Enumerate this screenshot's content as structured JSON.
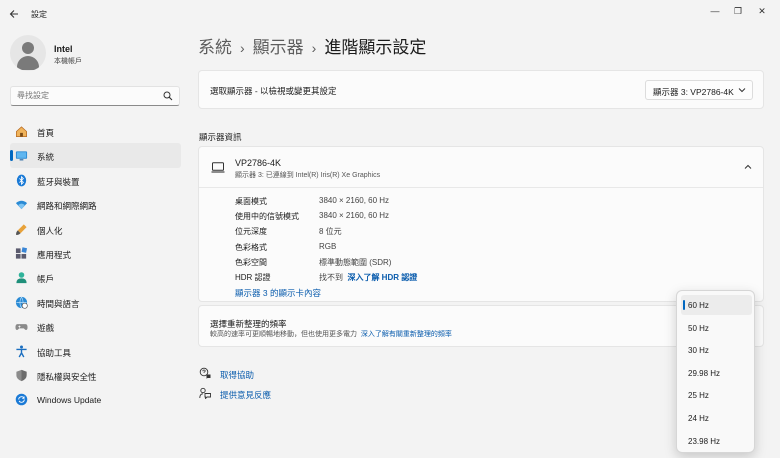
{
  "window": {
    "title": "設定",
    "back_icon": "back-arrow-icon",
    "minimize_glyph": "—",
    "maximize_glyph": "❐",
    "close_glyph": "✕"
  },
  "profile": {
    "name": "Intel",
    "subtitle": "本機帳戶"
  },
  "search": {
    "placeholder": "尋找設定"
  },
  "sidebar": {
    "items": [
      {
        "label": "首頁",
        "icon": "home-icon",
        "selected": false
      },
      {
        "label": "系統",
        "icon": "system-icon",
        "selected": true
      },
      {
        "label": "藍牙與裝置",
        "icon": "bluetooth-icon",
        "selected": false
      },
      {
        "label": "網路和網際網路",
        "icon": "wifi-icon",
        "selected": false
      },
      {
        "label": "個人化",
        "icon": "personalize-icon",
        "selected": false
      },
      {
        "label": "應用程式",
        "icon": "apps-icon",
        "selected": false
      },
      {
        "label": "帳戶",
        "icon": "accounts-icon",
        "selected": false
      },
      {
        "label": "時間與語言",
        "icon": "time-language-icon",
        "selected": false
      },
      {
        "label": "遊戲",
        "icon": "gaming-icon",
        "selected": false
      },
      {
        "label": "協助工具",
        "icon": "accessibility-icon",
        "selected": false
      },
      {
        "label": "隱私權與安全性",
        "icon": "privacy-shield-icon",
        "selected": false
      },
      {
        "label": "Windows Update",
        "icon": "windows-update-icon",
        "selected": false
      }
    ]
  },
  "breadcrumb": {
    "level1": "系統",
    "level2": "顯示器",
    "current": "進階顯示設定",
    "separator": "›"
  },
  "display_select": {
    "label": "選取顯示器 - 以檢視或變更其設定",
    "value": "顯示器 3: VP2786-4K"
  },
  "info_section": {
    "title": "顯示器資訊",
    "monitor_name": "VP2786-4K",
    "monitor_sub": "顯示器 3: 已連線到 Intel(R) Iris(R) Xe Graphics",
    "props": [
      {
        "key": "桌面模式",
        "value": "3840 × 2160, 60 Hz"
      },
      {
        "key": "使用中的信號模式",
        "value": "3840 × 2160, 60 Hz"
      },
      {
        "key": "位元深度",
        "value": "8 位元"
      },
      {
        "key": "色彩格式",
        "value": "RGB"
      },
      {
        "key": "色彩空間",
        "value": "標準動態範圍 (SDR)"
      }
    ],
    "hdr_key": "HDR 認證",
    "hdr_value": "找不到",
    "hdr_link": "深入了解 HDR 認證",
    "adapter_link": "顯示器 3 的顯示卡內容"
  },
  "refresh": {
    "title": "選擇重新整理的頻率",
    "subtitle": "較高的速率可更順暢地移動，但也使用更多電力",
    "link": "深入了解有關重新整理的頻率"
  },
  "help": {
    "get_help": "取得協助",
    "feedback": "提供意見反應"
  },
  "flyout": {
    "options": [
      "60 Hz",
      "50 Hz",
      "30 Hz",
      "29.98 Hz",
      "25 Hz",
      "24 Hz",
      "23.98 Hz"
    ],
    "selected_index": 0
  },
  "colors": {
    "accent": "#0067c0",
    "link": "#0a5cad",
    "background": "#f3f3f3",
    "card": "#fbfbfb"
  }
}
